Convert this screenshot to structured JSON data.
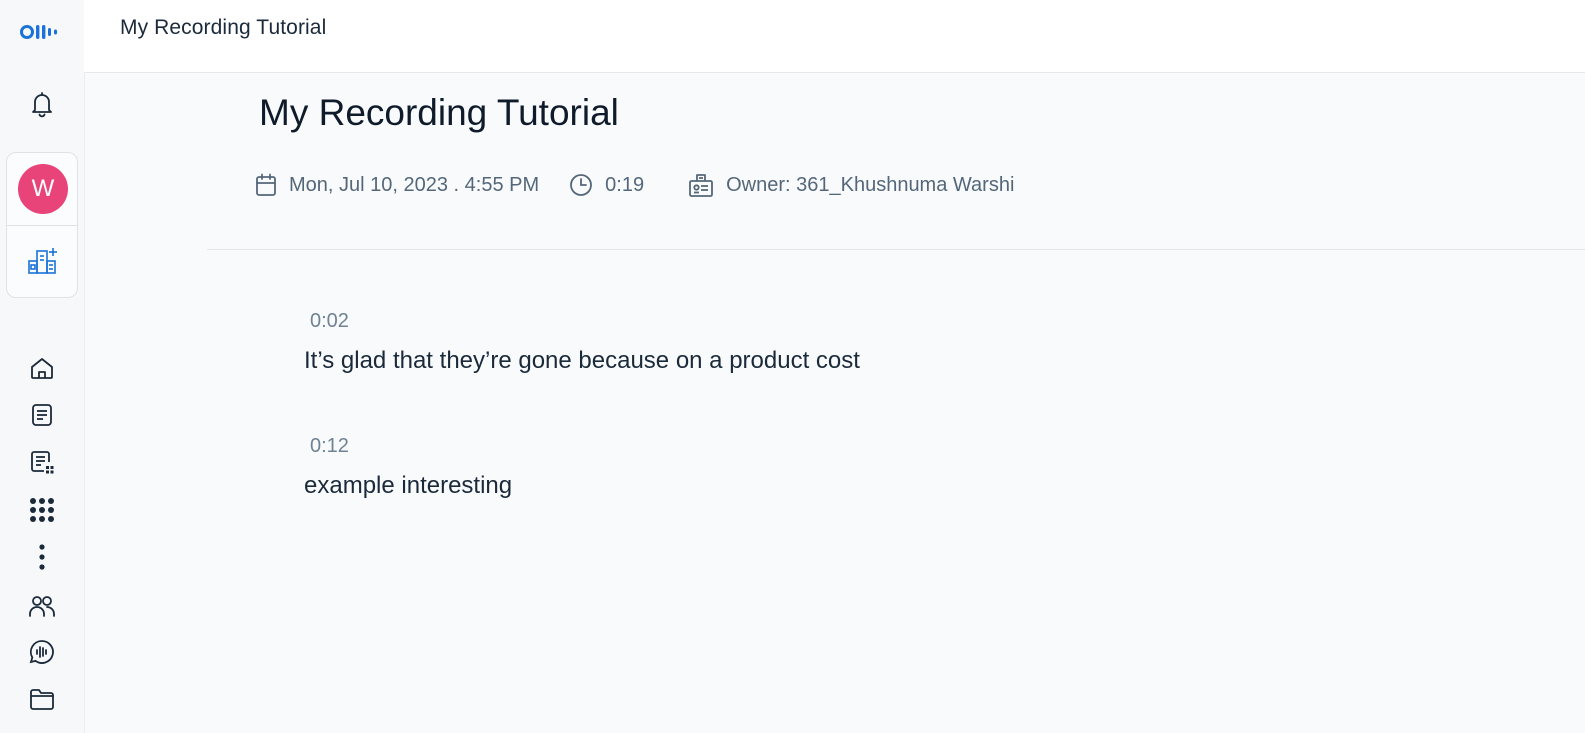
{
  "app": {
    "logo_icon": "otter-logo-icon",
    "brand_color": "#1a73d9"
  },
  "sidebar": {
    "top_icons": [
      "bell-icon"
    ],
    "workspace": {
      "avatar_letter": "W",
      "avatar_color": "#e8447a",
      "add_icon": "add-workspace-icon"
    },
    "nav_icons": [
      "home-icon",
      "notes-icon",
      "my-conversations-icon",
      "apps-grid-icon",
      "more-icon",
      "people-icon",
      "otter-chat-icon",
      "folder-icon"
    ]
  },
  "topbar": {
    "title": "My Recording Tutorial"
  },
  "recording": {
    "title": "My Recording Tutorial",
    "date": "Mon, Jul 10, 2023 . 4:55 PM",
    "duration": "0:19",
    "owner": "Owner: 361_Khushnuma Warshi"
  },
  "transcript": [
    {
      "time": "0:02",
      "text": "It’s glad that they’re gone because on a product cost"
    },
    {
      "time": "0:12",
      "text": "example interesting"
    }
  ]
}
